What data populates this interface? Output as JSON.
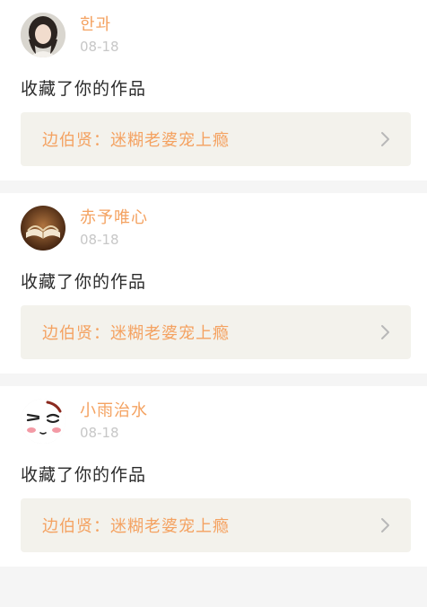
{
  "feed": {
    "items": [
      {
        "username": "한과",
        "date": "08-18",
        "action": "收藏了你的作品",
        "work_title": "边伯贤：迷糊老婆宠上瘾",
        "avatar_icon": "woman-portrait-avatar"
      },
      {
        "username": "赤予唯心",
        "date": "08-18",
        "action": "收藏了你的作品",
        "work_title": "边伯贤：迷糊老婆宠上瘾",
        "avatar_icon": "open-book-avatar"
      },
      {
        "username": "小雨治水",
        "date": "08-18",
        "action": "收藏了你的作品",
        "work_title": "边伯贤：迷糊老婆宠上瘾",
        "avatar_icon": "blushing-face-avatar"
      }
    ]
  },
  "colors": {
    "accent": "#f4a261",
    "date_gray": "#c7c7c7",
    "link_bg": "#f3f2ec",
    "page_bg": "#f5f5f5"
  }
}
